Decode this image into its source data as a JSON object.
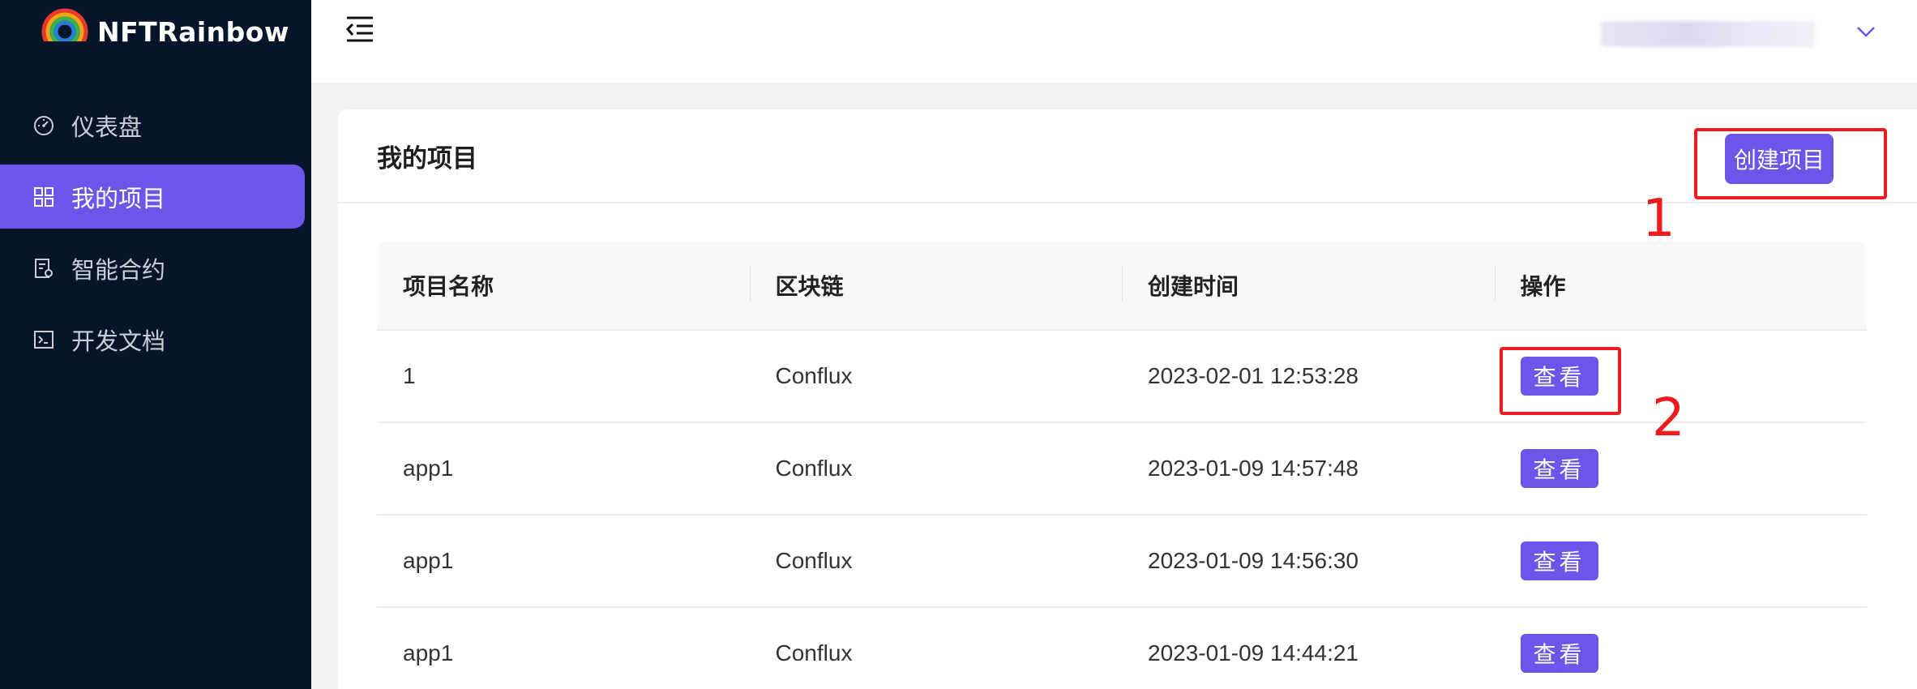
{
  "brand": {
    "name": "NFTRainbow",
    "logo_icon": "rainbow-logo-icon"
  },
  "sidebar": {
    "items": [
      {
        "label": "仪表盘",
        "icon": "dashboard-icon",
        "active": false
      },
      {
        "label": "我的项目",
        "icon": "grid-icon",
        "active": true
      },
      {
        "label": "智能合约",
        "icon": "contract-icon",
        "active": false
      },
      {
        "label": "开发文档",
        "icon": "terminal-icon",
        "active": false
      }
    ]
  },
  "header": {
    "collapse_icon": "menu-collapse-icon",
    "user_menu_icon": "chevron-down-icon"
  },
  "page": {
    "title": "我的项目",
    "create_label": "创建项目",
    "table": {
      "columns": [
        "项目名称",
        "区块链",
        "创建时间",
        "操作"
      ],
      "rows": [
        {
          "name": "1",
          "chain": "Conflux",
          "created": "2023-02-01 12:53:28",
          "action": "查看"
        },
        {
          "name": "app1",
          "chain": "Conflux",
          "created": "2023-01-09 14:57:48",
          "action": "查看"
        },
        {
          "name": "app1",
          "chain": "Conflux",
          "created": "2023-01-09 14:56:30",
          "action": "查看"
        },
        {
          "name": "app1",
          "chain": "Conflux",
          "created": "2023-01-09 14:44:21",
          "action": "查看"
        }
      ]
    }
  },
  "annotations": {
    "step1": "1",
    "step2": "2"
  },
  "colors": {
    "sidebar_bg": "#07152b",
    "accent": "#6c55e8",
    "annotation": "#ee1c1c"
  }
}
